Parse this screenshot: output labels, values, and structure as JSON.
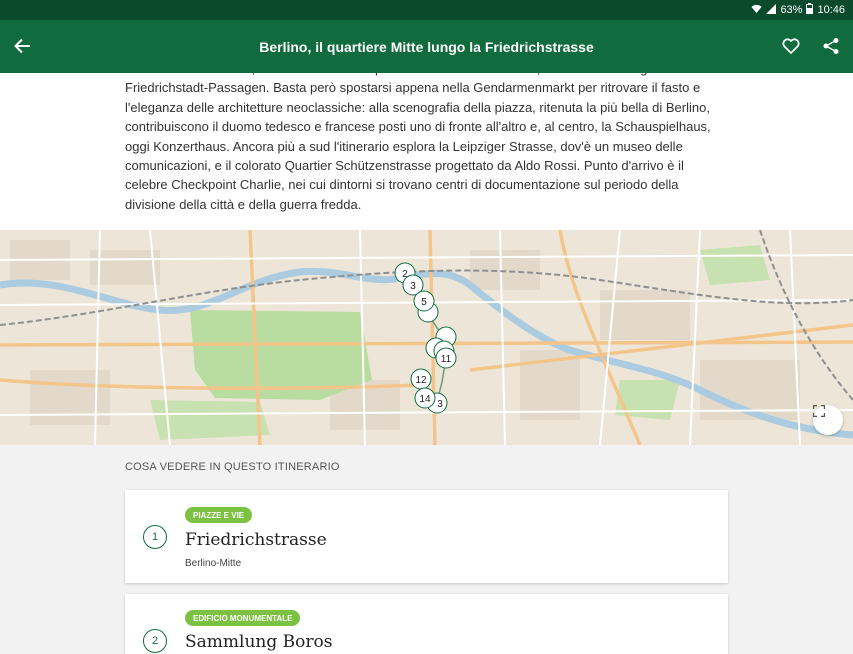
{
  "status": {
    "battery": "63%",
    "time": "10:46"
  },
  "appbar": {
    "title": "Berlino, il quartiere Mitte lungo la Friedrichstrasse"
  },
  "description": "stazione della S-Bahn, la strada si fa molto più commerciale e modaiola, con numerosi negozi e i famosi Friedrichstadt-Passagen. Basta però spostarsi appena nella Gendarmenmarkt per ritrovare il fasto e l'eleganza delle architetture neoclassiche: alla scenografia della piazza, ritenuta la più bella di Berlino, contribuiscono il duomo tedesco e francese posti uno di fronte all'altro e, al centro, la Schauspielhaus, oggi Konzerthaus. Ancora più a sud l'itinerario esplora la Leipziger Strasse, dov'è un museo delle comunicazioni, e il colorato Quartier Schützenstrasse progettato da Aldo Rossi. Punto d'arrivo è il celebre Checkpoint Charlie, nei cui dintorni si trovano centri di documentazione sul periodo della divisione della città e della guerra fredda.",
  "map": {
    "markers": [
      "2",
      "3",
      "5",
      "",
      "",
      "",
      "11",
      "12",
      "14",
      "3"
    ]
  },
  "section": {
    "title": "COSA VEDERE IN QUESTO ITINERARIO"
  },
  "items": [
    {
      "number": "1",
      "category": "PIAZZE E VIE",
      "name": "Friedrichstrasse",
      "location": "Berlino-Mitte"
    },
    {
      "number": "2",
      "category": "EDIFICIO MONUMENTALE",
      "name": "Sammlung Boros",
      "location": ""
    }
  ],
  "colors": {
    "primary": "#106b3e",
    "statusbar": "#0b4b2c",
    "badge": "#7cc242"
  }
}
